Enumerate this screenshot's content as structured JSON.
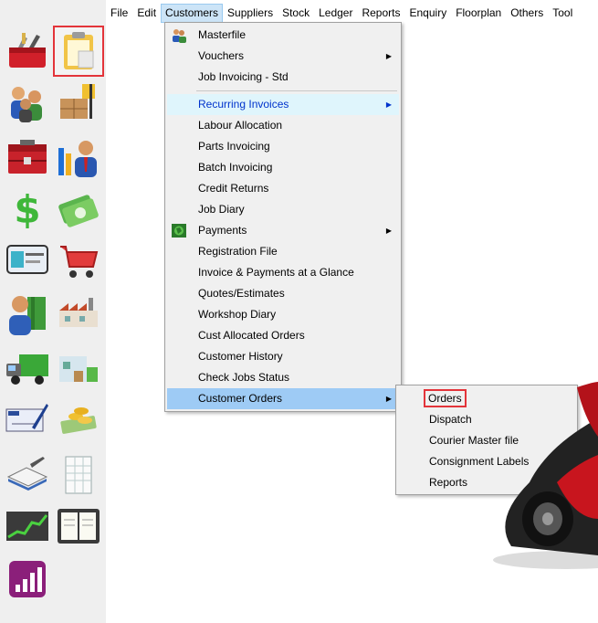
{
  "menubar": {
    "items": [
      "File",
      "Edit",
      "Customers",
      "Suppliers",
      "Stock",
      "Ledger",
      "Reports",
      "Enquiry",
      "Floorplan",
      "Others",
      "Tool"
    ],
    "active": "Customers"
  },
  "customers_menu": {
    "items": [
      {
        "label": "Masterfile",
        "icon": "people-icon",
        "submenu": false
      },
      {
        "label": "Vouchers",
        "submenu": true
      },
      {
        "label": "Job Invoicing - Std",
        "submenu": false
      },
      {
        "label": "Recurring Invoices",
        "submenu": true,
        "highlight": "light"
      },
      {
        "label": "Labour Allocation",
        "submenu": false
      },
      {
        "label": "Parts Invoicing",
        "submenu": false
      },
      {
        "label": "Batch Invoicing",
        "submenu": false
      },
      {
        "label": "Credit Returns",
        "submenu": false
      },
      {
        "label": "Job Diary",
        "submenu": false
      },
      {
        "label": "Payments",
        "icon": "globe-icon",
        "submenu": true
      },
      {
        "label": "Registration File",
        "submenu": false
      },
      {
        "label": "Invoice & Payments at a Glance",
        "submenu": false
      },
      {
        "label": "Quotes/Estimates",
        "submenu": false
      },
      {
        "label": "Workshop Diary",
        "submenu": false
      },
      {
        "label": "Cust Allocated Orders",
        "submenu": false
      },
      {
        "label": "Customer History",
        "submenu": false
      },
      {
        "label": "Check Jobs Status",
        "submenu": false
      },
      {
        "label": "Customer Orders",
        "submenu": true,
        "highlight": "selected"
      }
    ]
  },
  "customer_orders_submenu": {
    "items": [
      {
        "label": "Orders",
        "submenu": false,
        "boxed": true
      },
      {
        "label": "Dispatch",
        "submenu": false
      },
      {
        "label": "Courier Master file",
        "submenu": false
      },
      {
        "label": "Consignment Labels",
        "submenu": false
      },
      {
        "label": "Reports",
        "submenu": true
      }
    ]
  },
  "sidebar_icons": [
    "toolbox-icon",
    "clipboard-icon",
    "customers-icon",
    "forklift-icon",
    "tool-chest-icon",
    "manager-chart-icon",
    "dollar-icon",
    "money-icon",
    "credit-card-icon",
    "shopping-cart-icon",
    "user-book-icon",
    "factory-icon",
    "truck-icon",
    "warehouse-icon",
    "cheque-icon",
    "coins-icon",
    "ledger-book-icon",
    "spreadsheet-icon",
    "stock-chart-icon",
    "diary-icon",
    "bar-chart-icon"
  ],
  "colors": {
    "highlight_selected": "#9ecbf5",
    "highlight_light": "#dff5fc",
    "focus_box": "#e3343a",
    "sidebar_bg": "#efefef"
  }
}
